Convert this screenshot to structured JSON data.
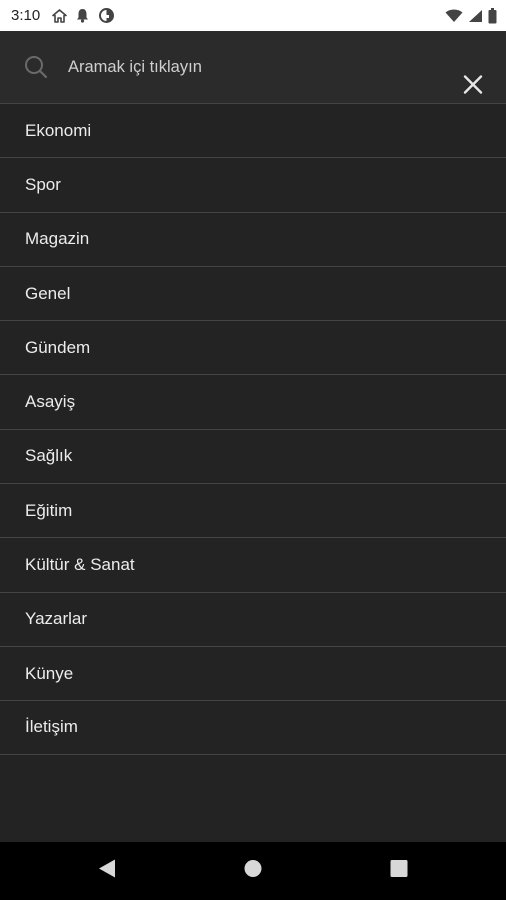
{
  "status_bar": {
    "time": "3:10",
    "icons_left": [
      "home-icon",
      "notification-bell-icon",
      "vpn-key-icon"
    ],
    "icons_right": [
      "wifi-icon",
      "cell-signal-icon",
      "battery-icon"
    ]
  },
  "search": {
    "placeholder": "Aramak içi tıklayın",
    "value": ""
  },
  "menu": {
    "items": [
      {
        "label": "Ekonomi"
      },
      {
        "label": "Spor"
      },
      {
        "label": "Magazin"
      },
      {
        "label": "Genel"
      },
      {
        "label": "Gündem"
      },
      {
        "label": "Asayiş"
      },
      {
        "label": "Sağlık"
      },
      {
        "label": "Eğitim"
      },
      {
        "label": "Kültür & Sanat"
      },
      {
        "label": "Yazarlar"
      },
      {
        "label": "Künye"
      },
      {
        "label": "İletişim"
      }
    ]
  },
  "nav_bar": {
    "buttons": [
      "back-icon",
      "home-circle-icon",
      "recents-square-icon"
    ]
  },
  "colors": {
    "background": "#232323",
    "search_bar": "#2b2b2b",
    "divider": "#444444",
    "text": "#ececec",
    "status_bar": "#ffffff",
    "nav_bar": "#000000"
  }
}
